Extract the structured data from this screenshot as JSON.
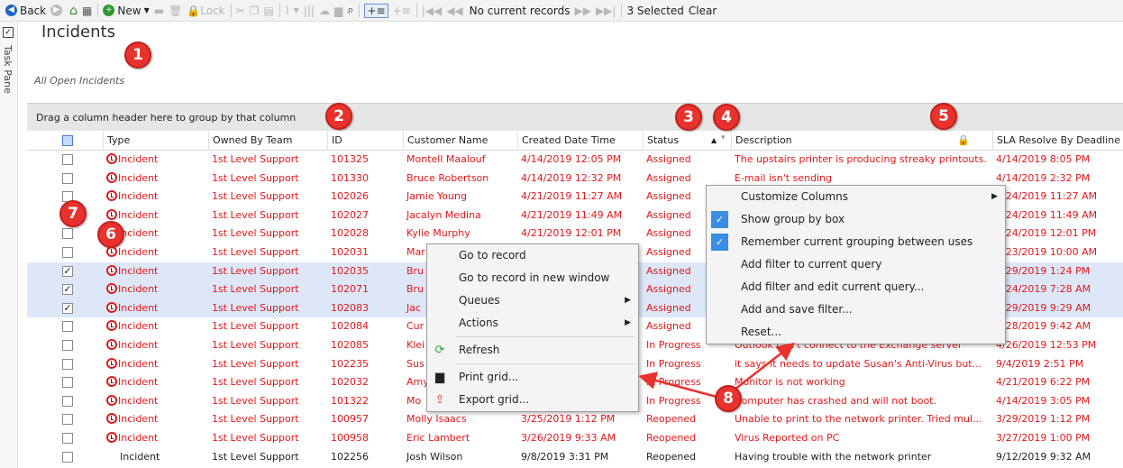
{
  "toolbar": {
    "back": "Back",
    "new": "New",
    "lock": "Lock",
    "no_records": "No current records",
    "selected": "3 Selected",
    "clear": "Clear"
  },
  "task_pane": {
    "label": "Task Pane"
  },
  "page": {
    "title": "Incidents",
    "subtitle": "All Open Incidents"
  },
  "group_bar": {
    "text": "Drag a column header here to group by that column"
  },
  "columns": [
    "Type",
    "Owned By Team",
    "ID",
    "Customer Name",
    "Created Date Time",
    "Status",
    "Description",
    "SLA Resolve By Deadline"
  ],
  "rows": [
    {
      "checked": false,
      "selected": false,
      "red": true,
      "type": "Incident",
      "team": "1st Level Support",
      "id": "101325",
      "customer": "Montell Maalouf",
      "created": "4/14/2019 12:05 PM",
      "status": "Assigned",
      "description": "The upstairs printer is producing streaky printouts.",
      "sla": "4/14/2019 8:05 PM"
    },
    {
      "checked": false,
      "selected": false,
      "red": true,
      "type": "Incident",
      "team": "1st Level Support",
      "id": "101330",
      "customer": "Bruce Robertson",
      "created": "4/14/2019 12:32 PM",
      "status": "Assigned",
      "description": "E-mail isn't sending",
      "sla": "4/14/2019 2:32 PM"
    },
    {
      "checked": false,
      "selected": false,
      "red": true,
      "type": "Incident",
      "team": "1st Level Support",
      "id": "102026",
      "customer": "Jamie Young",
      "created": "4/21/2019 11:27 AM",
      "status": "Assigned",
      "description": "",
      "sla": "4/24/2019 11:27 AM"
    },
    {
      "checked": false,
      "selected": false,
      "red": true,
      "type": "Incident",
      "team": "1st Level Support",
      "id": "102027",
      "customer": "Jacalyn Medina",
      "created": "4/21/2019 11:49 AM",
      "status": "Assigned",
      "description": "",
      "sla": "4/24/2019 11:49 AM"
    },
    {
      "checked": false,
      "selected": false,
      "red": true,
      "type": "Incident",
      "team": "1st Level Support",
      "id": "102028",
      "customer": "Kylie Murphy",
      "created": "4/21/2019 12:01 PM",
      "status": "Assigned",
      "description": "",
      "sla": "4/24/2019 12:01 PM"
    },
    {
      "checked": false,
      "selected": false,
      "red": true,
      "type": "Incident",
      "team": "1st Level Support",
      "id": "102031",
      "customer": "Mar",
      "created": "",
      "status": "Assigned",
      "description": "",
      "sla": "4/23/2019 10:00 AM"
    },
    {
      "checked": true,
      "selected": true,
      "red": true,
      "type": "Incident",
      "team": "1st Level Support",
      "id": "102035",
      "customer": "Bru",
      "created": "",
      "status": "Assigned",
      "description": "",
      "sla": "4/29/2019 1:24 PM"
    },
    {
      "checked": true,
      "selected": true,
      "red": true,
      "type": "Incident",
      "team": "1st Level Support",
      "id": "102071",
      "customer": "Bru",
      "created": "",
      "status": "Assigned",
      "description": "",
      "sla": "4/24/2019 7:28 AM"
    },
    {
      "checked": true,
      "selected": true,
      "red": true,
      "type": "Incident",
      "team": "1st Level Support",
      "id": "102083",
      "customer": "Jac",
      "created": "",
      "status": "Assigned",
      "description": "",
      "sla": "4/29/2019 9:29 AM"
    },
    {
      "checked": false,
      "selected": false,
      "red": true,
      "type": "Incident",
      "team": "1st Level Support",
      "id": "102084",
      "customer": "Cur",
      "created": "",
      "status": "Assigned",
      "description": "",
      "sla": "4/28/2019 9:42 AM"
    },
    {
      "checked": false,
      "selected": false,
      "red": true,
      "type": "Incident",
      "team": "1st Level Support",
      "id": "102085",
      "customer": "Klei",
      "created": "",
      "status": "In Progress",
      "description": "Outlook can't connect to the Exchange server",
      "sla": "4/26/2019 12:53 PM"
    },
    {
      "checked": false,
      "selected": false,
      "red": true,
      "type": "Incident",
      "team": "1st Level Support",
      "id": "102235",
      "customer": "Sus",
      "created": "",
      "status": "In Progress",
      "description": "it says it needs to update Susan's Anti-Virus but...",
      "sla": "9/4/2019 2:51 PM"
    },
    {
      "checked": false,
      "selected": false,
      "red": true,
      "type": "Incident",
      "team": "1st Level Support",
      "id": "102032",
      "customer": "Amy",
      "created": "",
      "status": "In Progress",
      "description": "Monitor is not working",
      "sla": "4/21/2019 6:22 PM"
    },
    {
      "checked": false,
      "selected": false,
      "red": true,
      "type": "Incident",
      "team": "1st Level Support",
      "id": "101322",
      "customer": "Mo",
      "created": "",
      "status": "In Progress",
      "description": "Computer has crashed and will not boot.",
      "sla": "4/14/2019 3:05 PM"
    },
    {
      "checked": false,
      "selected": false,
      "red": true,
      "type": "Incident",
      "team": "1st Level Support",
      "id": "100957",
      "customer": "Molly Isaacs",
      "created": "3/25/2019 1:12 PM",
      "status": "Reopened",
      "description": "Unable to print to the network printer. Tried mul...",
      "sla": "3/29/2019 1:12 PM"
    },
    {
      "checked": false,
      "selected": false,
      "red": true,
      "type": "Incident",
      "team": "1st Level Support",
      "id": "100958",
      "customer": "Eric Lambert",
      "created": "3/26/2019 9:33 AM",
      "status": "Reopened",
      "description": "Virus Reported on PC",
      "sla": "3/27/2019 1:00 PM"
    },
    {
      "checked": false,
      "selected": false,
      "red": false,
      "type": "Incident",
      "team": "1st Level Support",
      "id": "102256",
      "customer": "Josh Wilson",
      "created": "9/8/2019 3:31 PM",
      "status": "Reopened",
      "description": "Having trouble with the network printer",
      "sla": "9/12/2019 9:32 AM"
    }
  ],
  "row_context_menu": [
    {
      "label": "Go to record",
      "icon": "",
      "submenu": false
    },
    {
      "label": "Go to record in new window",
      "icon": "",
      "submenu": false
    },
    {
      "label": "Queues",
      "icon": "",
      "submenu": true
    },
    {
      "label": "Actions",
      "icon": "",
      "submenu": true
    },
    {
      "label": "Refresh",
      "icon": "refresh-icon",
      "submenu": false
    },
    {
      "label": "Print grid...",
      "icon": "print-icon",
      "submenu": false
    },
    {
      "label": "Export grid...",
      "icon": "export-icon",
      "submenu": false
    }
  ],
  "header_context_menu": [
    {
      "label": "Customize Columns",
      "checked": false,
      "submenu": true
    },
    {
      "label": "Show group by box",
      "checked": true,
      "submenu": false
    },
    {
      "label": "Remember current grouping between uses",
      "checked": true,
      "submenu": false
    },
    {
      "label": "Add filter to current query",
      "checked": false,
      "submenu": false
    },
    {
      "label": "Add filter and edit current query...",
      "checked": false,
      "submenu": false
    },
    {
      "label": "Add and save filter...",
      "checked": false,
      "submenu": false
    },
    {
      "label": "Reset...",
      "checked": false,
      "submenu": false
    }
  ],
  "callouts": [
    "1",
    "2",
    "3",
    "4",
    "5",
    "6",
    "7",
    "8"
  ],
  "colors": {
    "overdue_text": "#e0181b",
    "selected_row": "#dde7f8",
    "callout": "#e8322e",
    "menu_check": "#3a8ee6"
  }
}
